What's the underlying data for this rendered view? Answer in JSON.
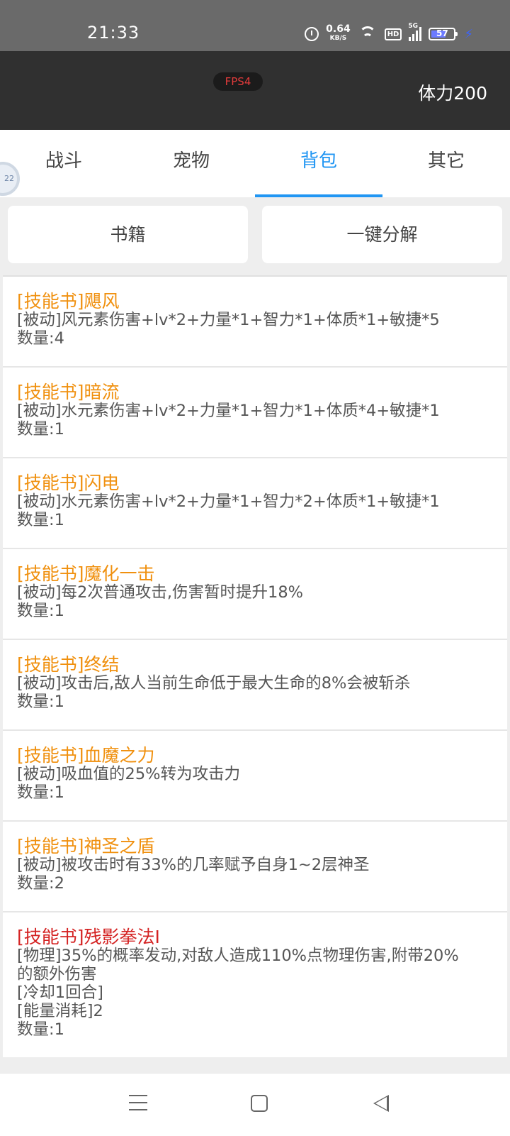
{
  "status_bar": {
    "time": "21:33",
    "speed_value": "0.64",
    "speed_unit": "KB/S",
    "hd_label": "HD",
    "network_label": "5G",
    "battery": "57"
  },
  "header": {
    "fps_badge": "FPS4",
    "stamina": "体力200"
  },
  "tabs": [
    {
      "label": "战斗",
      "active": false
    },
    {
      "label": "宠物",
      "active": false
    },
    {
      "label": "背包",
      "active": true
    },
    {
      "label": "其它",
      "active": false
    }
  ],
  "float_badge": "22",
  "actions": {
    "books_label": "书籍",
    "decompose_label": "一键分解"
  },
  "items": [
    {
      "name": "[技能书]飓风",
      "desc": "[被动]风元素伤害+lv*2+力量*1+智力*1+体质*1+敏捷*5",
      "count": "数量:4"
    },
    {
      "name": "[技能书]暗流",
      "desc": "[被动]水元素伤害+lv*2+力量*1+智力*1+体质*4+敏捷*1",
      "count": "数量:1"
    },
    {
      "name": "[技能书]闪电",
      "desc": "[被动]水元素伤害+lv*2+力量*1+智力*2+体质*1+敏捷*1",
      "count": "数量:1"
    },
    {
      "name": "[技能书]魔化一击",
      "desc": "[被动]每2次普通攻击,伤害暂时提升18%",
      "count": "数量:1"
    },
    {
      "name": "[技能书]终结",
      "desc": "[被动]攻击后,敌人当前生命低于最大生命的8%会被斩杀",
      "count": "数量:1"
    },
    {
      "name": "[技能书]血魔之力",
      "desc": "[被动]吸血值的25%转为攻击力",
      "count": "数量:1"
    },
    {
      "name": "[技能书]神圣之盾",
      "desc": "[被动]被攻击时有33%的几率赋予自身1~2层神圣",
      "count": "数量:2"
    },
    {
      "name": "[技能书]残影拳法I",
      "desc": "[物理]35%的概率发动,对敌人造成110%点物理伤害,附带20%的额外伤害",
      "cooldown": "[冷却1回合]",
      "energy": "[能量消耗]2",
      "count": "数量:1"
    }
  ],
  "colors": {
    "accent": "#2196f3",
    "item_name": "#f0900e",
    "item_name_rare": "#d42222",
    "fps_text": "#e23b3b"
  },
  "icons": [
    "alarm-icon",
    "wifi-icon",
    "signal-icon",
    "battery-icon",
    "charging-icon",
    "menu-icon",
    "home-icon",
    "back-icon"
  ]
}
